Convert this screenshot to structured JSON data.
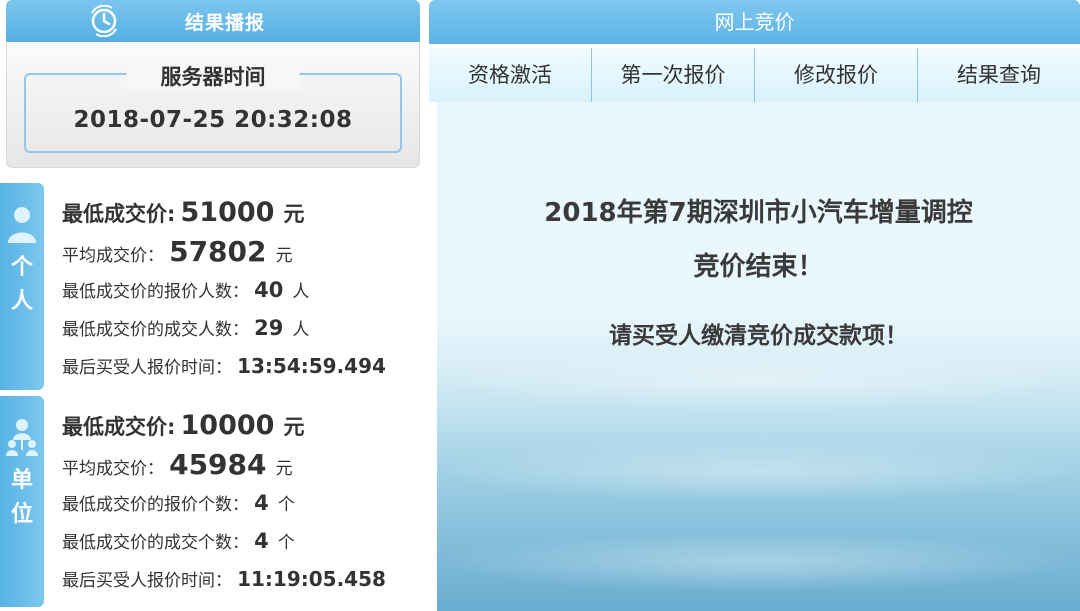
{
  "left": {
    "header": {
      "title": "结果播报",
      "icon": "clock-refresh-icon"
    },
    "server": {
      "label": "服务器时间",
      "time": "2018-07-25 20:32:08"
    },
    "person": {
      "tab_label": [
        "个",
        "人"
      ],
      "icon": "person-icon",
      "min_price_label": "最低成交价:",
      "min_price": "51000",
      "min_price_unit": "元",
      "avg_price_label": "平均成交价：",
      "avg_price": "57802",
      "avg_price_unit": "元",
      "bid_count_label": "最低成交价的报价人数：",
      "bid_count": "40",
      "bid_count_unit": "人",
      "deal_count_label": "最低成交价的成交人数：",
      "deal_count": "29",
      "deal_count_unit": "人",
      "last_time_label": "最后买受人报价时间：",
      "last_time": "13:54:59.494"
    },
    "unit": {
      "tab_label": [
        "单",
        "位"
      ],
      "icon": "organization-icon",
      "min_price_label": "最低成交价:",
      "min_price": "10000",
      "min_price_unit": "元",
      "avg_price_label": "平均成交价：",
      "avg_price": "45984",
      "avg_price_unit": "元",
      "bid_count_label": "最低成交价的报价个数：",
      "bid_count": "4",
      "bid_count_unit": "个",
      "deal_count_label": "最低成交价的成交个数：",
      "deal_count": "4",
      "deal_count_unit": "个",
      "last_time_label": "最后买受人报价时间：",
      "last_time": "11:19:05.458"
    }
  },
  "right": {
    "header": {
      "title": "网上竞价"
    },
    "tabs": [
      {
        "label": "资格激活"
      },
      {
        "label": "第一次报价"
      },
      {
        "label": "修改报价"
      },
      {
        "label": "结果查询"
      }
    ],
    "message": {
      "line1": "2018年第7期深圳市小汽车增量调控",
      "line2": "竞价结束！",
      "line3": "请买受人缴清竞价成交款项！"
    }
  },
  "colors": {
    "header_blue": "#5cb4e6",
    "tab_blue": "#58b3e5",
    "text": "#333333"
  }
}
